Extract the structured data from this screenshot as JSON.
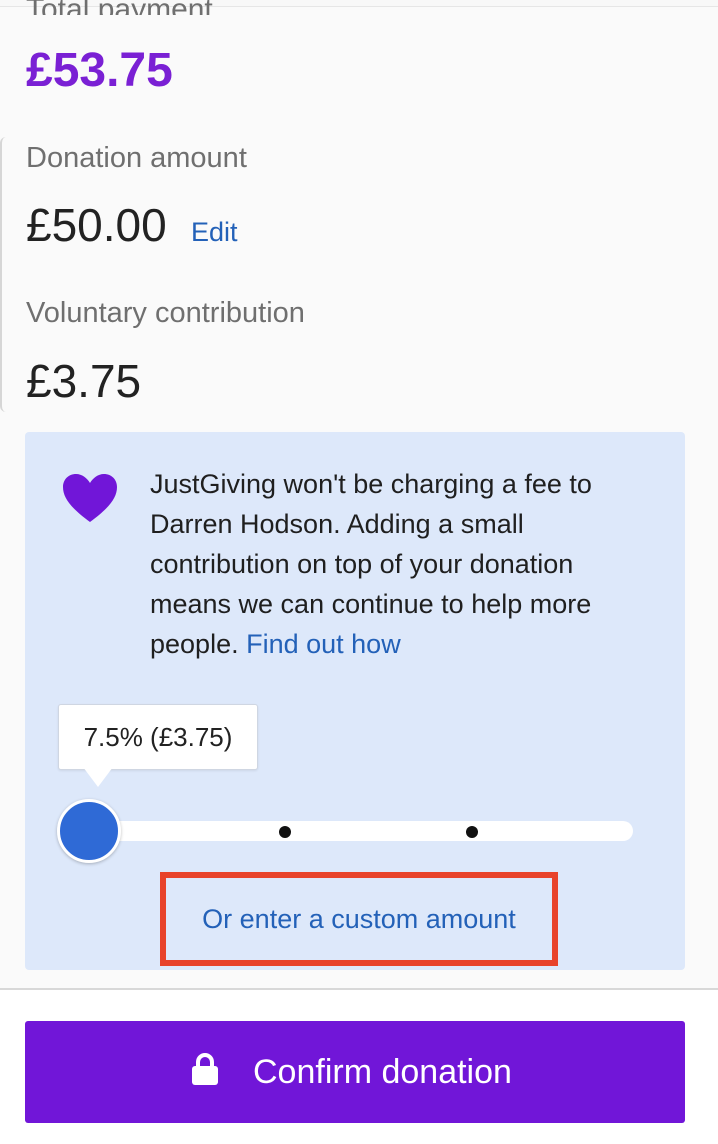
{
  "summary": {
    "total_label": "Total payment",
    "total_amount": "£53.75",
    "donation_label": "Donation amount",
    "donation_amount": "£50.00",
    "edit_label": "Edit",
    "contribution_label": "Voluntary contribution",
    "contribution_amount": "£3.75"
  },
  "info": {
    "icon": "heart-icon",
    "message": "JustGiving won't be charging a fee to Darren Hodson. Adding a small contribution on top of your donation means we can continue to help more people.",
    "link_label": "Find out how"
  },
  "slider": {
    "tooltip": "7.5% (£3.75)",
    "value_percent": 7.5,
    "stops": 3
  },
  "custom_amount_label": "Or enter a custom amount",
  "confirm_button": {
    "icon": "lock-icon",
    "label": "Confirm donation"
  },
  "colors": {
    "brand_purple": "#7116d8",
    "link_blue": "#2361b8",
    "info_background": "#dde8fa",
    "slider_thumb": "#2f6ad6",
    "highlight_red": "#e8432a"
  }
}
